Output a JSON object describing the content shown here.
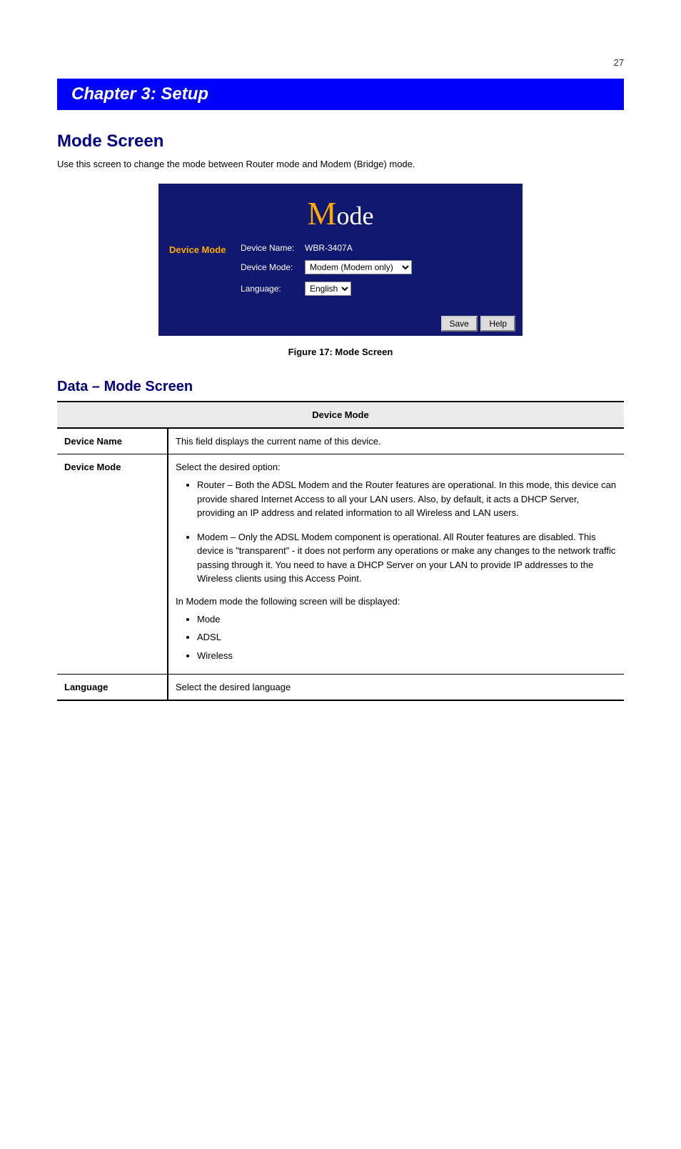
{
  "pageNumber": "27",
  "header": "Chapter 3: Setup",
  "section": {
    "title": "Mode Screen",
    "intro": "Use this screen to change the mode between Router mode and Modem (Bridge) mode."
  },
  "modePanel": {
    "title_prefix": "M",
    "title_rest": "ode",
    "sectionLabel": "Device Mode",
    "deviceName": {
      "label": "Device Name:",
      "value": "WBR-3407A"
    },
    "deviceMode": {
      "label": "Device Mode:",
      "selected": "Modem (Modem only)"
    },
    "language": {
      "label": "Language:",
      "selected": "English"
    },
    "buttons": {
      "save": "Save",
      "help": "Help"
    }
  },
  "figureCaption": "Figure 17: Mode Screen",
  "dataSection": {
    "heading": "Data – Mode Screen",
    "tableHeader": "Device Mode",
    "rows": {
      "deviceName": {
        "label": "Device Name",
        "text": "This field displays the current name of this device."
      },
      "deviceMode": {
        "label": "Device Mode",
        "intro": "Select the desired option:",
        "bullets": [
          "Router – Both the ADSL Modem and the Router features are operational. In this mode, this device can provide shared Internet Access to all your LAN users. Also, by default, it acts a DHCP Server, providing an IP address and related information to all Wireless and LAN users.",
          "Modem – Only the ADSL Modem component is operational. All Router features are disabled. This device is \"transparent\" - it does not perform any operations or make any changes to the network traffic passing through it. You need to have a DHCP Server on your LAN to provide IP addresses to the Wireless clients using this Access Point."
        ],
        "subText": "In Modem mode the following screen will be displayed:",
        "screens": [
          "Mode",
          "ADSL",
          "Wireless"
        ]
      },
      "language": {
        "label": "Language",
        "text": "Select the desired language"
      }
    }
  }
}
